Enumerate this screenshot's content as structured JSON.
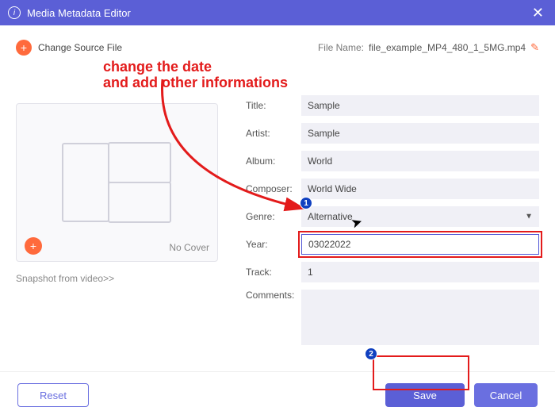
{
  "window": {
    "title": "Media Metadata Editor"
  },
  "topbar": {
    "change": "Change Source File",
    "filename_label": "File Name:",
    "filename": "file_example_MP4_480_1_5MG.mp4"
  },
  "annot": {
    "line1": "change the date",
    "line2": "and add other informations"
  },
  "cover": {
    "nocover": "No Cover",
    "snapshot": "Snapshot from video>>"
  },
  "labels": {
    "title": "Title:",
    "artist": "Artist:",
    "album": "Album:",
    "composer": "Composer:",
    "genre": "Genre:",
    "year": "Year:",
    "track": "Track:",
    "comments": "Comments:"
  },
  "values": {
    "title": "Sample",
    "artist": "Sample",
    "album": "World",
    "composer": "World Wide",
    "genre": "Alternative",
    "year": "03022022",
    "track": "1",
    "comments": ""
  },
  "buttons": {
    "reset": "Reset",
    "save": "Save",
    "cancel": "Cancel"
  }
}
